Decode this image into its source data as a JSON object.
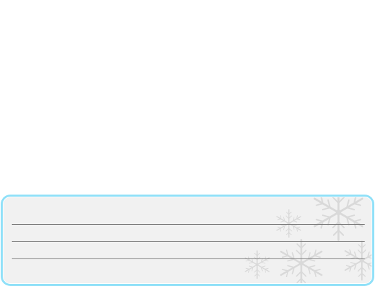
{
  "message_box": {
    "lines": [
      "",
      "",
      "",
      ""
    ],
    "decoration": "snowflake-icon",
    "frame_color": "#8fe0f8",
    "panel_color": "#f1f1f1",
    "rule_color": "#7a7a7a"
  }
}
